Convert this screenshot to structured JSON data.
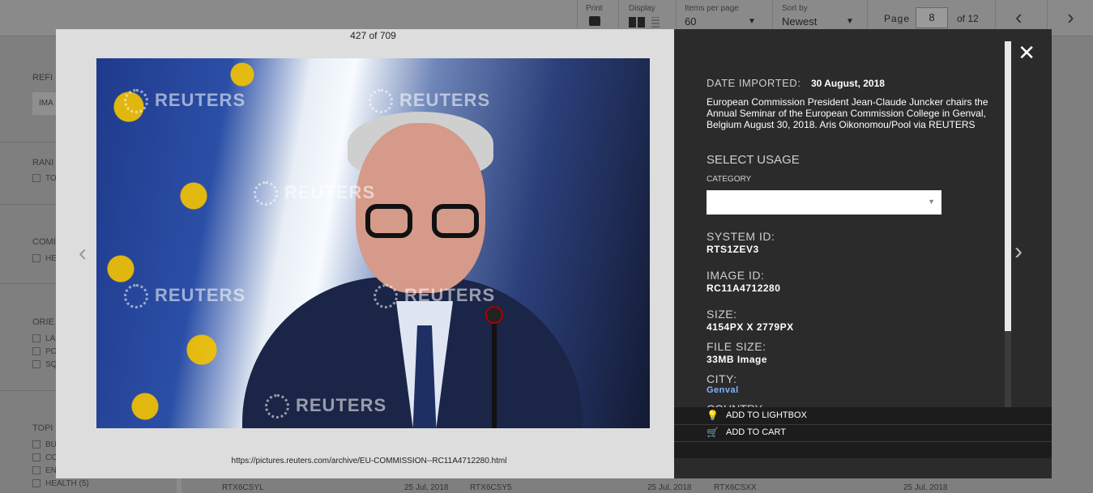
{
  "toolbar": {
    "print_label": "Print",
    "display_label": "Display",
    "items_label": "Items per page",
    "items_value": "60",
    "sort_label": "Sort by",
    "sort_value": "Newest",
    "page_label": "Page",
    "page_value": "8",
    "page_total": "of 12"
  },
  "sidebar": {
    "refine_label": "REFI",
    "input_value": "IMA",
    "rank_label": "RANI",
    "rank_item": "TO",
    "comm_label": "COMI",
    "comm_item": "HE",
    "orient_label": "ORIE",
    "orient_items": [
      "LA",
      "PO",
      "SQ"
    ],
    "topic_label": "TOPI",
    "topic_items": [
      "BU",
      "CO",
      "EN",
      "HEALTH (5)"
    ]
  },
  "background_rows": [
    {
      "id": "RTX6CSYL",
      "date": "25 Jul, 2018"
    },
    {
      "id": "RTX6CSY5",
      "date": "25 Jul, 2018"
    },
    {
      "id": "RTX6CSXX",
      "date": "25 Jul, 2018"
    }
  ],
  "viewer": {
    "counter": "427 of 709",
    "watermark": "REUTERS",
    "url": "https://pictures.reuters.com/archive/EU-COMMISSION--RC11A4712280.html"
  },
  "details": {
    "date_label": "DATE IMPORTED:",
    "date_value": "30 August, 2018",
    "caption": "European Commission President Jean-Claude Juncker chairs the Annual Seminar of the European Commission College in Genval, Belgium August 30, 2018. Aris Oikonomou/Pool via REUTERS",
    "select_usage": "SELECT USAGE",
    "category_label": "CATEGORY",
    "category_value": "",
    "system_id_label": "SYSTEM ID:",
    "system_id": "RTS1ZEV3",
    "image_id_label": "IMAGE ID:",
    "image_id": "RC11A4712280",
    "size_label": "SIZE:",
    "size": "4154PX X 2779PX",
    "file_size_label": "FILE SIZE:",
    "file_size": "33MB Image",
    "city_label": "CITY:",
    "city": "Genval",
    "country_label": "COUNTRY"
  },
  "actions": {
    "lightbox": "ADD TO LIGHTBOX",
    "cart": "ADD TO CART"
  },
  "icons": {
    "close": "close-icon",
    "next": "chevron-right-icon",
    "prev": "chevron-left-icon",
    "lightbox": "lightbulb-icon",
    "cart": "cart-icon",
    "print": "printer-icon"
  }
}
